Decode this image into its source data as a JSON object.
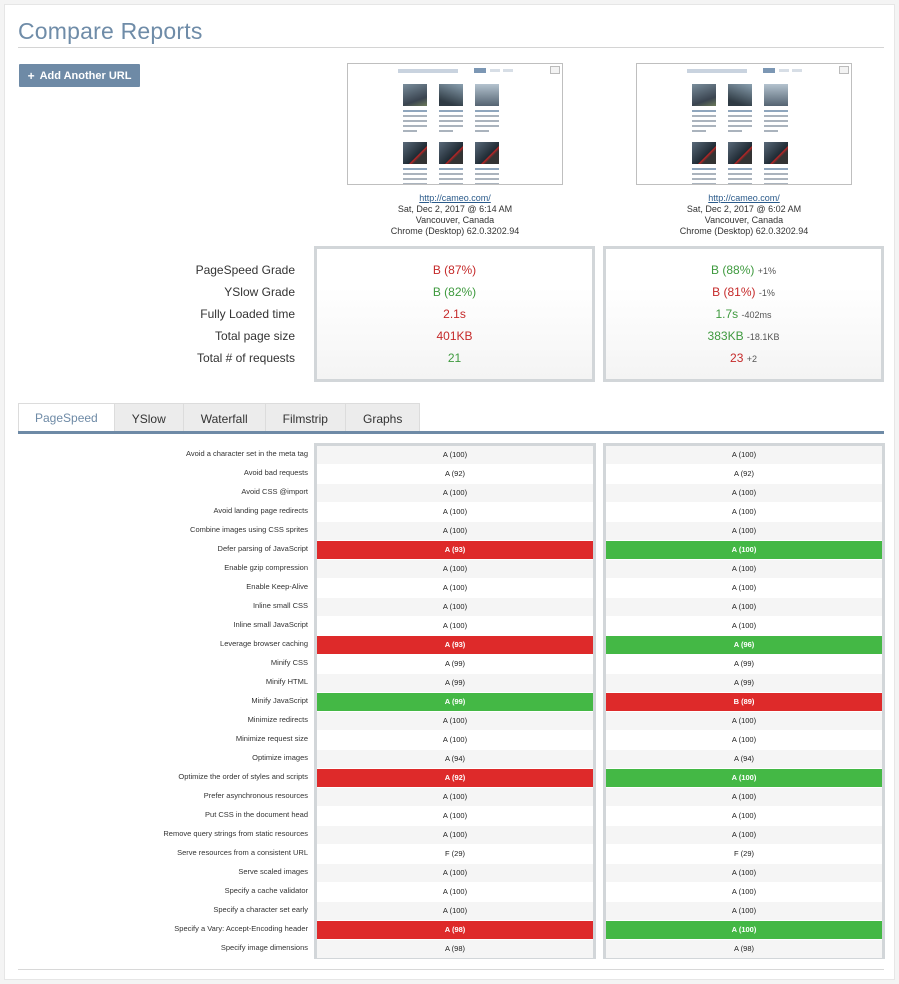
{
  "header": {
    "title": "Compare Reports",
    "add_url_label": "Add Another URL"
  },
  "reports": [
    {
      "url": "http://cameo.com/",
      "date": "Sat, Dec 2, 2017 @ 6:14 AM",
      "location": "Vancouver, Canada",
      "browser": "Chrome (Desktop) 62.0.3202.94"
    },
    {
      "url": "http://cameo.com/",
      "date": "Sat, Dec 2, 2017 @ 6:02 AM",
      "location": "Vancouver, Canada",
      "browser": "Chrome (Desktop) 62.0.3202.94"
    }
  ],
  "summary_labels": [
    "PageSpeed Grade",
    "YSlow Grade",
    "Fully Loaded time",
    "Total page size",
    "Total # of requests"
  ],
  "summary": [
    [
      {
        "value": "B (87%)",
        "color": "red",
        "delta": ""
      },
      {
        "value": "B (82%)",
        "color": "green",
        "delta": ""
      },
      {
        "value": "2.1s",
        "color": "red",
        "delta": ""
      },
      {
        "value": "401KB",
        "color": "red",
        "delta": ""
      },
      {
        "value": "21",
        "color": "green",
        "delta": ""
      }
    ],
    [
      {
        "value": "B (88%)",
        "color": "green",
        "delta": "+1%"
      },
      {
        "value": "B (81%)",
        "color": "red",
        "delta": "-1%"
      },
      {
        "value": "1.7s",
        "color": "green",
        "delta": "-402ms"
      },
      {
        "value": "383KB",
        "color": "green",
        "delta": "-18.1KB"
      },
      {
        "value": "23",
        "color": "red",
        "delta": "+2"
      }
    ]
  ],
  "tabs": [
    "PageSpeed",
    "YSlow",
    "Waterfall",
    "Filmstrip",
    "Graphs"
  ],
  "active_tab": "PageSpeed",
  "rules": [
    {
      "name": "Avoid a character set in the meta tag",
      "left": "A (100)",
      "right": "A (100)",
      "ls": "",
      "rs": ""
    },
    {
      "name": "Avoid bad requests",
      "left": "A (92)",
      "right": "A (92)",
      "ls": "",
      "rs": ""
    },
    {
      "name": "Avoid CSS @import",
      "left": "A (100)",
      "right": "A (100)",
      "ls": "",
      "rs": ""
    },
    {
      "name": "Avoid landing page redirects",
      "left": "A (100)",
      "right": "A (100)",
      "ls": "",
      "rs": ""
    },
    {
      "name": "Combine images using CSS sprites",
      "left": "A (100)",
      "right": "A (100)",
      "ls": "",
      "rs": ""
    },
    {
      "name": "Defer parsing of JavaScript",
      "left": "A (93)",
      "right": "A (100)",
      "ls": "bad",
      "rs": "good"
    },
    {
      "name": "Enable gzip compression",
      "left": "A (100)",
      "right": "A (100)",
      "ls": "",
      "rs": ""
    },
    {
      "name": "Enable Keep-Alive",
      "left": "A (100)",
      "right": "A (100)",
      "ls": "",
      "rs": ""
    },
    {
      "name": "Inline small CSS",
      "left": "A (100)",
      "right": "A (100)",
      "ls": "",
      "rs": ""
    },
    {
      "name": "Inline small JavaScript",
      "left": "A (100)",
      "right": "A (100)",
      "ls": "",
      "rs": ""
    },
    {
      "name": "Leverage browser caching",
      "left": "A (93)",
      "right": "A (96)",
      "ls": "bad",
      "rs": "good"
    },
    {
      "name": "Minify CSS",
      "left": "A (99)",
      "right": "A (99)",
      "ls": "",
      "rs": ""
    },
    {
      "name": "Minify HTML",
      "left": "A (99)",
      "right": "A (99)",
      "ls": "",
      "rs": ""
    },
    {
      "name": "Minify JavaScript",
      "left": "A (99)",
      "right": "B (89)",
      "ls": "good",
      "rs": "bad"
    },
    {
      "name": "Minimize redirects",
      "left": "A (100)",
      "right": "A (100)",
      "ls": "",
      "rs": ""
    },
    {
      "name": "Minimize request size",
      "left": "A (100)",
      "right": "A (100)",
      "ls": "",
      "rs": ""
    },
    {
      "name": "Optimize images",
      "left": "A (94)",
      "right": "A (94)",
      "ls": "",
      "rs": ""
    },
    {
      "name": "Optimize the order of styles and scripts",
      "left": "A (92)",
      "right": "A (100)",
      "ls": "bad",
      "rs": "good"
    },
    {
      "name": "Prefer asynchronous resources",
      "left": "A (100)",
      "right": "A (100)",
      "ls": "",
      "rs": ""
    },
    {
      "name": "Put CSS in the document head",
      "left": "A (100)",
      "right": "A (100)",
      "ls": "",
      "rs": ""
    },
    {
      "name": "Remove query strings from static resources",
      "left": "A (100)",
      "right": "A (100)",
      "ls": "",
      "rs": ""
    },
    {
      "name": "Serve resources from a consistent URL",
      "left": "F (29)",
      "right": "F (29)",
      "ls": "",
      "rs": ""
    },
    {
      "name": "Serve scaled images",
      "left": "A (100)",
      "right": "A (100)",
      "ls": "",
      "rs": ""
    },
    {
      "name": "Specify a cache validator",
      "left": "A (100)",
      "right": "A (100)",
      "ls": "",
      "rs": ""
    },
    {
      "name": "Specify a character set early",
      "left": "A (100)",
      "right": "A (100)",
      "ls": "",
      "rs": ""
    },
    {
      "name": "Specify a Vary: Accept-Encoding header",
      "left": "A (98)",
      "right": "A (100)",
      "ls": "bad",
      "rs": "good"
    },
    {
      "name": "Specify image dimensions",
      "left": "A (98)",
      "right": "A (98)",
      "ls": "",
      "rs": ""
    }
  ]
}
